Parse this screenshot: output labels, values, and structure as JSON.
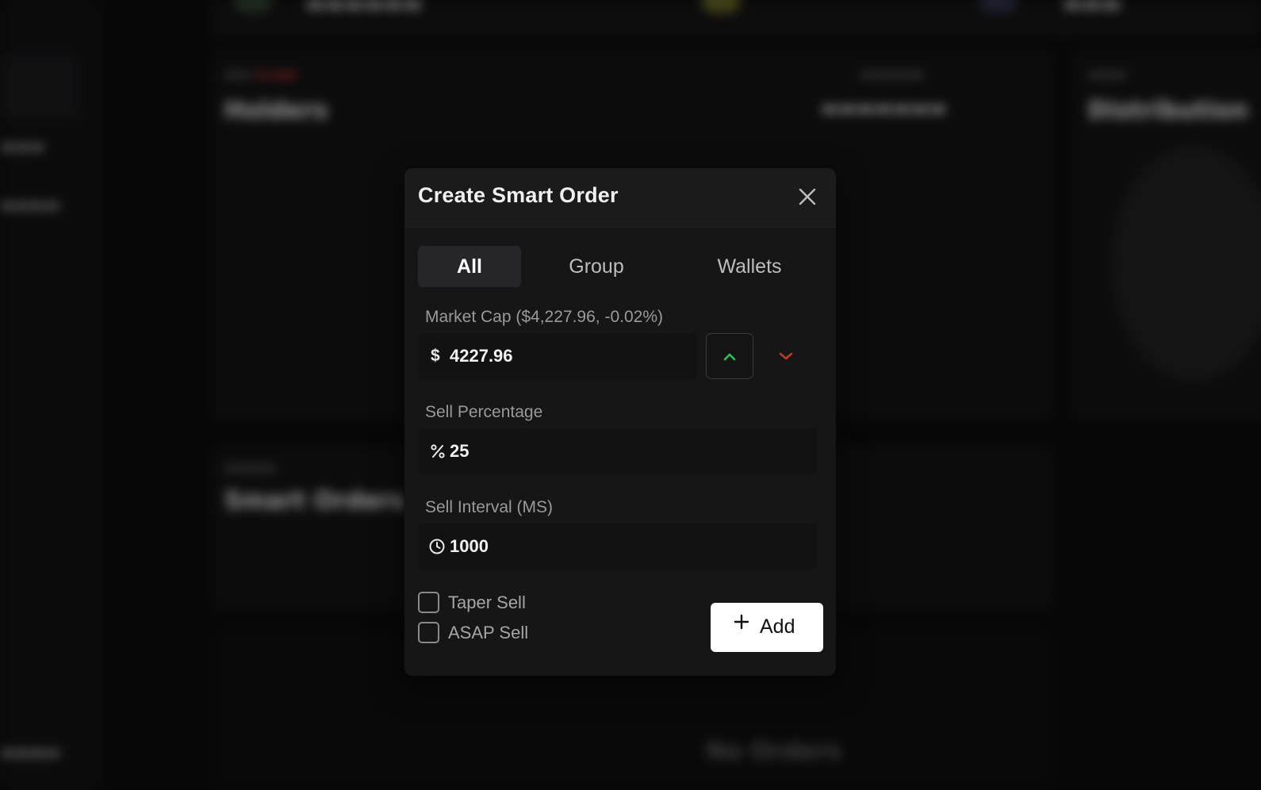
{
  "modal": {
    "title": "Create Smart Order",
    "tabs": [
      {
        "label": "All",
        "active": true
      },
      {
        "label": "Group",
        "active": false
      },
      {
        "label": "Wallets",
        "active": false
      }
    ],
    "market_cap": {
      "label": "Market Cap ($4,227.96, -0.02%)",
      "prefix": "$",
      "value": "4227.96",
      "up_color": "#22c55e",
      "down_color": "#c0392b"
    },
    "sell_percentage": {
      "label": "Sell Percentage",
      "prefix_icon": "percent-icon",
      "value": "25"
    },
    "sell_interval": {
      "label": "Sell Interval (MS)",
      "prefix_icon": "clock-icon",
      "value": "1000"
    },
    "options": [
      {
        "label": "Taper Sell",
        "checked": false
      },
      {
        "label": "ASAP Sell",
        "checked": false
      }
    ],
    "add_button": {
      "label": "Add"
    }
  },
  "background": {
    "holders_title": "Holders",
    "distribution_title": "Distribution",
    "smart_orders_title": "Smart Orders",
    "no_orders": "No Orders"
  }
}
